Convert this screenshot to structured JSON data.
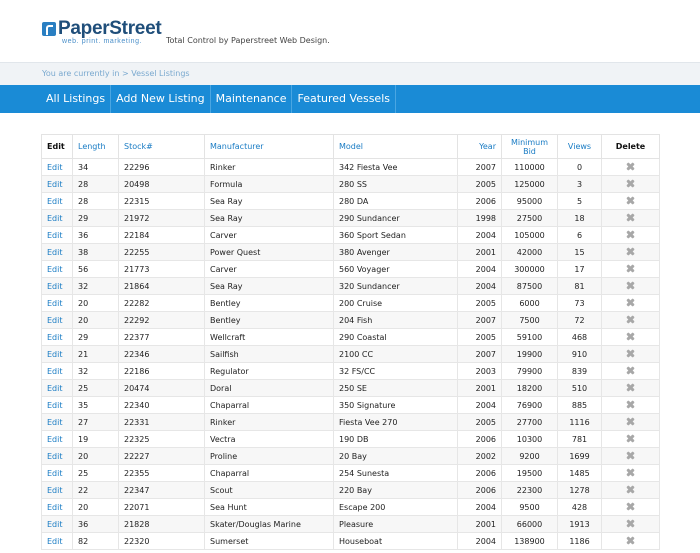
{
  "header": {
    "logo_name": "PaperStreet",
    "logo_tagline": "web. print. marketing.",
    "tagline": "Total Control by Paperstreet Web Design."
  },
  "breadcrumb": "You are currently in > Vessel Listings",
  "nav": [
    "All Listings",
    "Add New Listing",
    "Maintenance",
    "Featured Vessels"
  ],
  "table": {
    "columns": [
      "Edit",
      "Length",
      "Stock#",
      "Manufacturer",
      "Model",
      "Year",
      "Minimum Bid",
      "Views",
      "Delete"
    ],
    "edit_label": "Edit",
    "rows": [
      [
        "34",
        "22296",
        "Rinker",
        "342 Fiesta Vee",
        "2007",
        "110000",
        "0"
      ],
      [
        "28",
        "20498",
        "Formula",
        "280 SS",
        "2005",
        "125000",
        "3"
      ],
      [
        "28",
        "22315",
        "Sea Ray",
        "280 DA",
        "2006",
        "95000",
        "5"
      ],
      [
        "29",
        "21972",
        "Sea Ray",
        "290 Sundancer",
        "1998",
        "27500",
        "18"
      ],
      [
        "36",
        "22184",
        "Carver",
        "360 Sport Sedan",
        "2004",
        "105000",
        "6"
      ],
      [
        "38",
        "22255",
        "Power Quest",
        "380 Avenger",
        "2001",
        "42000",
        "15"
      ],
      [
        "56",
        "21773",
        "Carver",
        "560 Voyager",
        "2004",
        "300000",
        "17"
      ],
      [
        "32",
        "21864",
        "Sea Ray",
        "320 Sundancer",
        "2004",
        "87500",
        "81"
      ],
      [
        "20",
        "22282",
        "Bentley",
        "200 Cruise",
        "2005",
        "6000",
        "73"
      ],
      [
        "20",
        "22292",
        "Bentley",
        "204 Fish",
        "2007",
        "7500",
        "72"
      ],
      [
        "29",
        "22377",
        "Wellcraft",
        "290 Coastal",
        "2005",
        "59100",
        "468"
      ],
      [
        "21",
        "22346",
        "Sailfish",
        "2100 CC",
        "2007",
        "19900",
        "910"
      ],
      [
        "32",
        "22186",
        "Regulator",
        "32 FS/CC",
        "2003",
        "79900",
        "839"
      ],
      [
        "25",
        "20474",
        "Doral",
        "250 SE",
        "2001",
        "18200",
        "510"
      ],
      [
        "35",
        "22340",
        "Chaparral",
        "350 Signature",
        "2004",
        "76900",
        "885"
      ],
      [
        "27",
        "22331",
        "Rinker",
        "Fiesta Vee 270",
        "2005",
        "27700",
        "1116"
      ],
      [
        "19",
        "22325",
        "Vectra",
        "190 DB",
        "2006",
        "10300",
        "781"
      ],
      [
        "20",
        "22227",
        "Proline",
        "20 Bay",
        "2002",
        "9200",
        "1699"
      ],
      [
        "25",
        "22355",
        "Chaparral",
        "254 Sunesta",
        "2006",
        "19500",
        "1485"
      ],
      [
        "22",
        "22347",
        "Scout",
        "220 Bay",
        "2006",
        "22300",
        "1278"
      ],
      [
        "20",
        "22071",
        "Sea Hunt",
        "Escape 200",
        "2004",
        "9500",
        "428"
      ],
      [
        "36",
        "21828",
        "Skater/Douglas Marine",
        "Pleasure",
        "2001",
        "66000",
        "1913"
      ],
      [
        "82",
        "22320",
        "Sumerset",
        "Houseboat",
        "2004",
        "138900",
        "1186"
      ]
    ]
  },
  "icons": {
    "delete": "delete-x-icon",
    "logo": "paperstreet-logo-icon"
  },
  "colors": {
    "nav_bg": "#1a8bd6",
    "link": "#1a7cc4",
    "breadcrumb_bg": "#f0f3f6"
  }
}
